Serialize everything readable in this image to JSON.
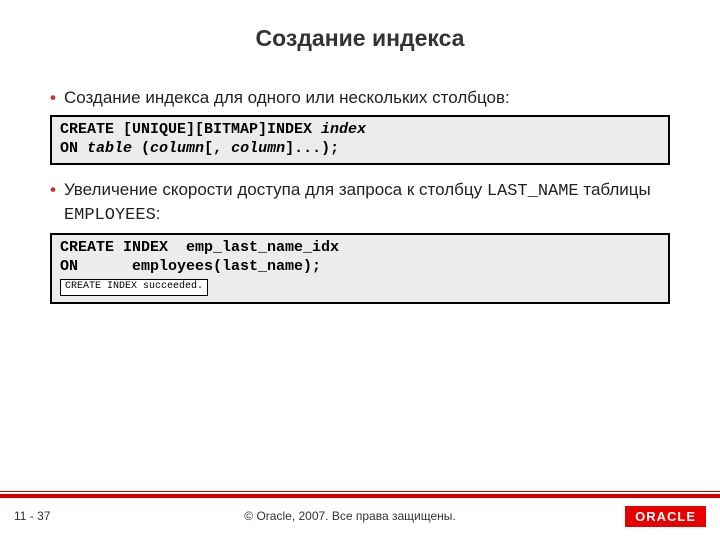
{
  "title": "Создание индекса",
  "bullets": {
    "b1": "Создание индекса для одного или нескольких столбцов:",
    "b2_part1": "Увеличение скорости доступа для запроса к столбцу ",
    "b2_code1": "LAST_NAME",
    "b2_part2": " таблицы ",
    "b2_code2": "EMPLOYEES",
    "b2_part3": ":"
  },
  "code1": {
    "line1a": "CREATE [UNIQUE][BITMAP]INDEX ",
    "line1b": "index",
    "line2a": "ON ",
    "line2b": "table",
    "line2c": " (",
    "line2d": "column",
    "line2e": "[, ",
    "line2f": "column",
    "line2g": "]...);"
  },
  "code2": {
    "line1": "CREATE INDEX  emp_last_name_idx",
    "line2": "ON      employees(last_name);",
    "result": "CREATE INDEX succeeded."
  },
  "footer": {
    "page": "11 - 37",
    "copyright": "© Oracle, 2007. Все права защищены.",
    "logo": "ORACLE"
  }
}
